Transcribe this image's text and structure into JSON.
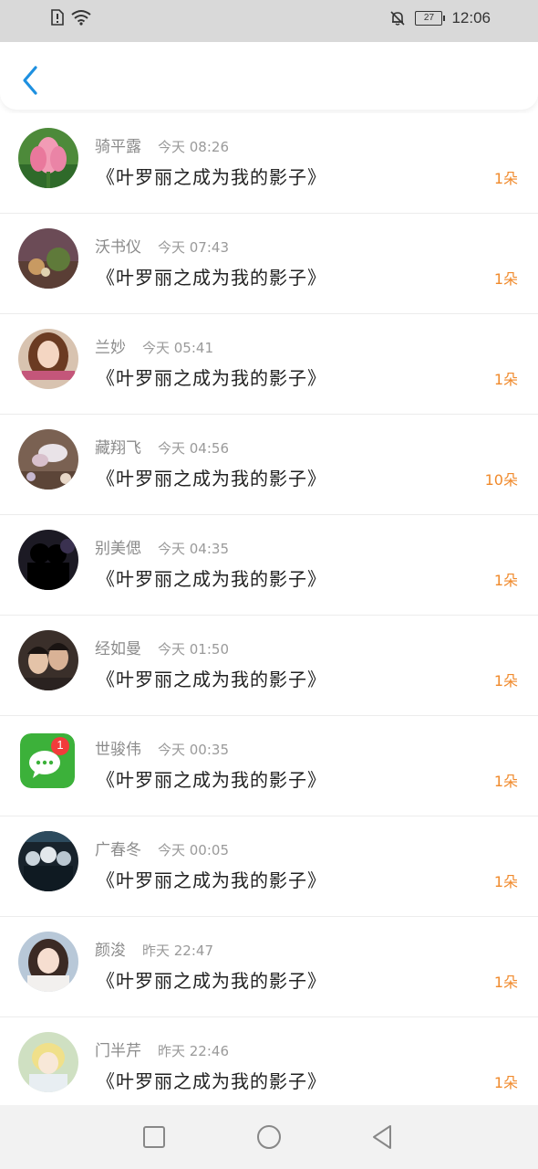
{
  "status_bar": {
    "time": "12:06",
    "battery": "27",
    "icons": [
      "sim-alert-icon",
      "wifi-icon",
      "bell-off-icon",
      "battery-icon"
    ]
  },
  "header": {
    "back_icon": "chevron-left-icon",
    "accent_color": "#1e90e0"
  },
  "list": {
    "items": [
      {
        "name": "骑平露",
        "time": "今天 08:26",
        "title": "《叶罗丽之成为我的影子》",
        "count": "1朵",
        "avatar": "lotus"
      },
      {
        "name": "沃书仪",
        "time": "今天 07:43",
        "title": "《叶罗丽之成为我的影子》",
        "count": "1朵",
        "avatar": "still-life"
      },
      {
        "name": "兰妙",
        "time": "今天 05:41",
        "title": "《叶罗丽之成为我的影子》",
        "count": "1朵",
        "avatar": "girl-portrait"
      },
      {
        "name": "藏翔飞",
        "time": "今天 04:56",
        "title": "《叶罗丽之成为我的影子》",
        "count": "10朵",
        "avatar": "flowers"
      },
      {
        "name": "别美偲",
        "time": "今天 04:35",
        "title": "《叶罗丽之成为我的影子》",
        "count": "1朵",
        "avatar": "silhouette"
      },
      {
        "name": "经如曼",
        "time": "今天 01:50",
        "title": "《叶罗丽之成为我的影子》",
        "count": "1朵",
        "avatar": "couple"
      },
      {
        "name": "世骏伟",
        "time": "今天 00:35",
        "title": "《叶罗丽之成为我的影子》",
        "count": "1朵",
        "avatar": "wechat",
        "badge": "1"
      },
      {
        "name": "广春冬",
        "time": "今天 00:05",
        "title": "《叶罗丽之成为我的影子》",
        "count": "1朵",
        "avatar": "crowd"
      },
      {
        "name": "颜浚",
        "time": "昨天 22:47",
        "title": "《叶罗丽之成为我的影子》",
        "count": "1朵",
        "avatar": "anime-girl"
      },
      {
        "name": "门半芹",
        "time": "昨天 22:46",
        "title": "《叶罗丽之成为我的影子》",
        "count": "1朵",
        "avatar": "anime-boy"
      }
    ]
  },
  "nav_bar": {
    "buttons": [
      "recent-apps-icon",
      "home-icon",
      "back-triangle-icon"
    ]
  },
  "colors": {
    "count_color": "#f08a2c",
    "name_color": "#8b8b8b",
    "title_color": "#222222"
  }
}
